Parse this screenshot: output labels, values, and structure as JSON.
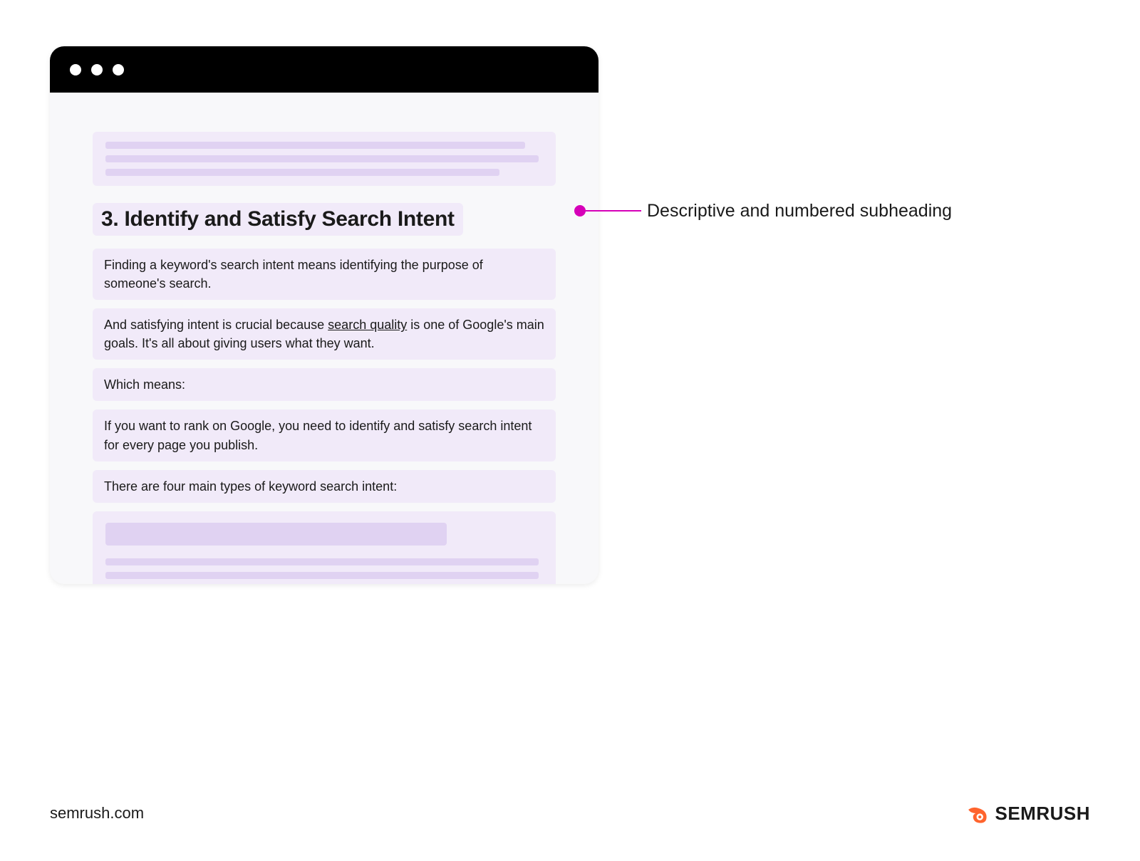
{
  "content": {
    "heading": "3. Identify and Satisfy Search Intent",
    "para1": "Finding a keyword's search intent means identifying the purpose of someone's search.",
    "para2_pre": "And satisfying intent is crucial because ",
    "para2_link": "search quality",
    "para2_post": " is one of Google's main goals. It's all about giving users what they want.",
    "para3": "Which means:",
    "para4": "If you want to rank on Google, you need to identify and satisfy search intent for every page you publish.",
    "para5": "There are four main types of keyword search intent:"
  },
  "annotation": {
    "label": "Descriptive and numbered subheading"
  },
  "footer": {
    "site": "semrush.com",
    "brand": "SEMRUSH"
  }
}
